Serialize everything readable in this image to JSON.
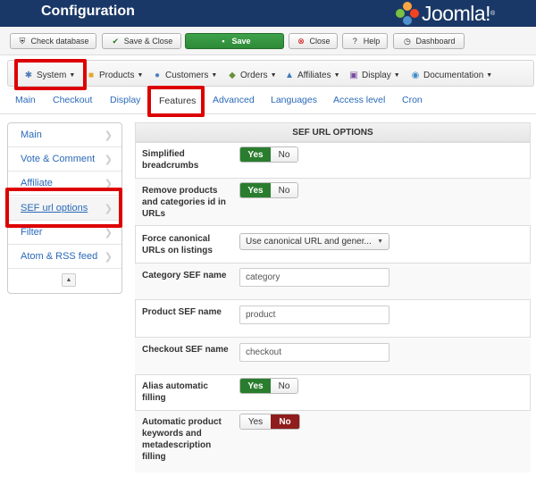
{
  "header": {
    "title": "Configuration",
    "logo_text": "Joomla!",
    "logo_reg": "®"
  },
  "toolbar": {
    "check_database": "Check database",
    "save_close": "Save & Close",
    "save": "Save",
    "close": "Close",
    "help": "Help",
    "dashboard": "Dashboard"
  },
  "menu": [
    {
      "label": "System",
      "icon": "wrench-icon"
    },
    {
      "label": "Products",
      "icon": "box-icon"
    },
    {
      "label": "Customers",
      "icon": "users-icon"
    },
    {
      "label": "Orders",
      "icon": "cart-icon"
    },
    {
      "label": "Affiliates",
      "icon": "affiliate-icon"
    },
    {
      "label": "Display",
      "icon": "display-icon"
    },
    {
      "label": "Documentation",
      "icon": "globe-icon"
    }
  ],
  "tabs": [
    "Main",
    "Checkout",
    "Display",
    "Features",
    "Advanced",
    "Languages",
    "Access level",
    "Cron"
  ],
  "active_tab": "Features",
  "sidebar": {
    "items": [
      "Main",
      "Vote & Comment",
      "Affiliate",
      "SEF url options",
      "Filter",
      "Atom & RSS feed"
    ],
    "active": "SEF url options"
  },
  "panel": {
    "title": "SEF URL OPTIONS",
    "rows": [
      {
        "label": "Simplified breadcrumbs",
        "type": "toggle",
        "value": "Yes"
      },
      {
        "label": "Remove products and categories id in URLs",
        "type": "toggle",
        "value": "Yes"
      },
      {
        "label": "Force canonical URLs on listings",
        "type": "select",
        "value": "Use canonical URL and gener..."
      },
      {
        "label": "Category SEF name",
        "type": "text",
        "value": "category"
      },
      {
        "label": "Product SEF name",
        "type": "text",
        "value": "product"
      },
      {
        "label": "Checkout SEF name",
        "type": "text",
        "value": "checkout"
      },
      {
        "label": "Alias automatic filling",
        "type": "toggle",
        "value": "Yes"
      },
      {
        "label": "Automatic product keywords and metadescription filling",
        "type": "toggle",
        "value": "No"
      }
    ],
    "yes_label": "Yes",
    "no_label": "No"
  },
  "colors": {
    "header": "#1a3867",
    "link": "#2a69b8",
    "yes_on": "#2a7d2e",
    "no_on": "#8f1d1d",
    "highlight": "#dd0000"
  }
}
